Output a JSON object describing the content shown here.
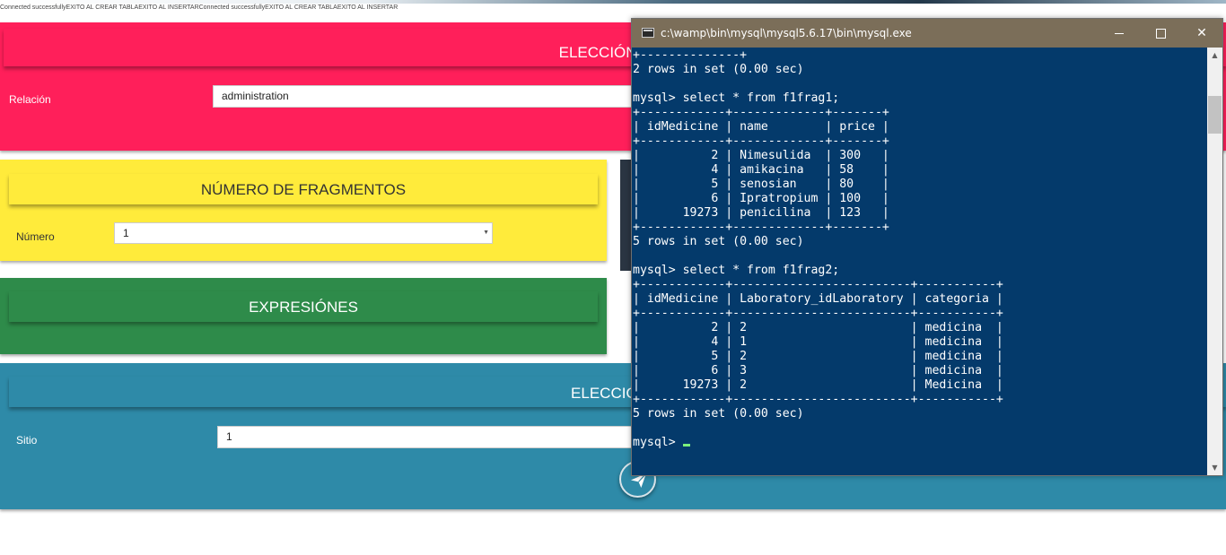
{
  "status_text": "Connected successfullyEXITO AL CREAR TABLAEXITO AL INSERTARConnected successfullyEXITO AL CREAR TABLAEXITO AL INSERTAR",
  "relation_section": {
    "title": "ELECCIÓN DEL",
    "label": "Relación",
    "value": "administration",
    "color": "#ff1f5a"
  },
  "fragments_section": {
    "title": "NÚMERO DE FRAGMENTOS",
    "label": "Número",
    "selected": "1",
    "color": "#ffeb3b"
  },
  "expressions_section": {
    "title": "EXPRESIÓNES",
    "color": "#2e8b4a"
  },
  "site_section": {
    "title": "ELECCIÓN D",
    "label": "Sitio",
    "value": "1",
    "color": "#2e8aa8"
  },
  "fab": {
    "icon": "send-icon"
  },
  "console": {
    "title": "c:\\wamp\\bin\\mysql\\mysql5.6.17\\bin\\mysql.exe",
    "buttons": {
      "minimize": "minimize",
      "maximize": "maximize",
      "close": "✕"
    },
    "lines": [
      "+--------------+",
      "2 rows in set (0.00 sec)",
      "",
      "mysql> select * from f1frag1;",
      "+------------+-------------+-------+",
      "| idMedicine | name        | price |",
      "+------------+-------------+-------+",
      "|          2 | Nimesulida  | 300   |",
      "|          4 | amikacina   | 58    |",
      "|          5 | senosian    | 80    |",
      "|          6 | Ipratropium | 100   |",
      "|      19273 | penicilina  | 123   |",
      "+------------+-------------+-------+",
      "5 rows in set (0.00 sec)",
      "",
      "mysql> select * from f1frag2;",
      "+------------+-------------------------+-----------+",
      "| idMedicine | Laboratory_idLaboratory | categoria |",
      "+------------+-------------------------+-----------+",
      "|          2 | 2                       | medicina  |",
      "|          4 | 1                       | medicina  |",
      "|          5 | 2                       | medicina  |",
      "|          6 | 3                       | medicina  |",
      "|      19273 | 2                       | Medicina  |",
      "+------------+-------------------------+-----------+",
      "5 rows in set (0.00 sec)",
      ""
    ],
    "prompt": "mysql> ",
    "colors": {
      "background": "#043a6b",
      "titlebar": "#7b6e59",
      "cursor": "#7cf07c"
    }
  }
}
